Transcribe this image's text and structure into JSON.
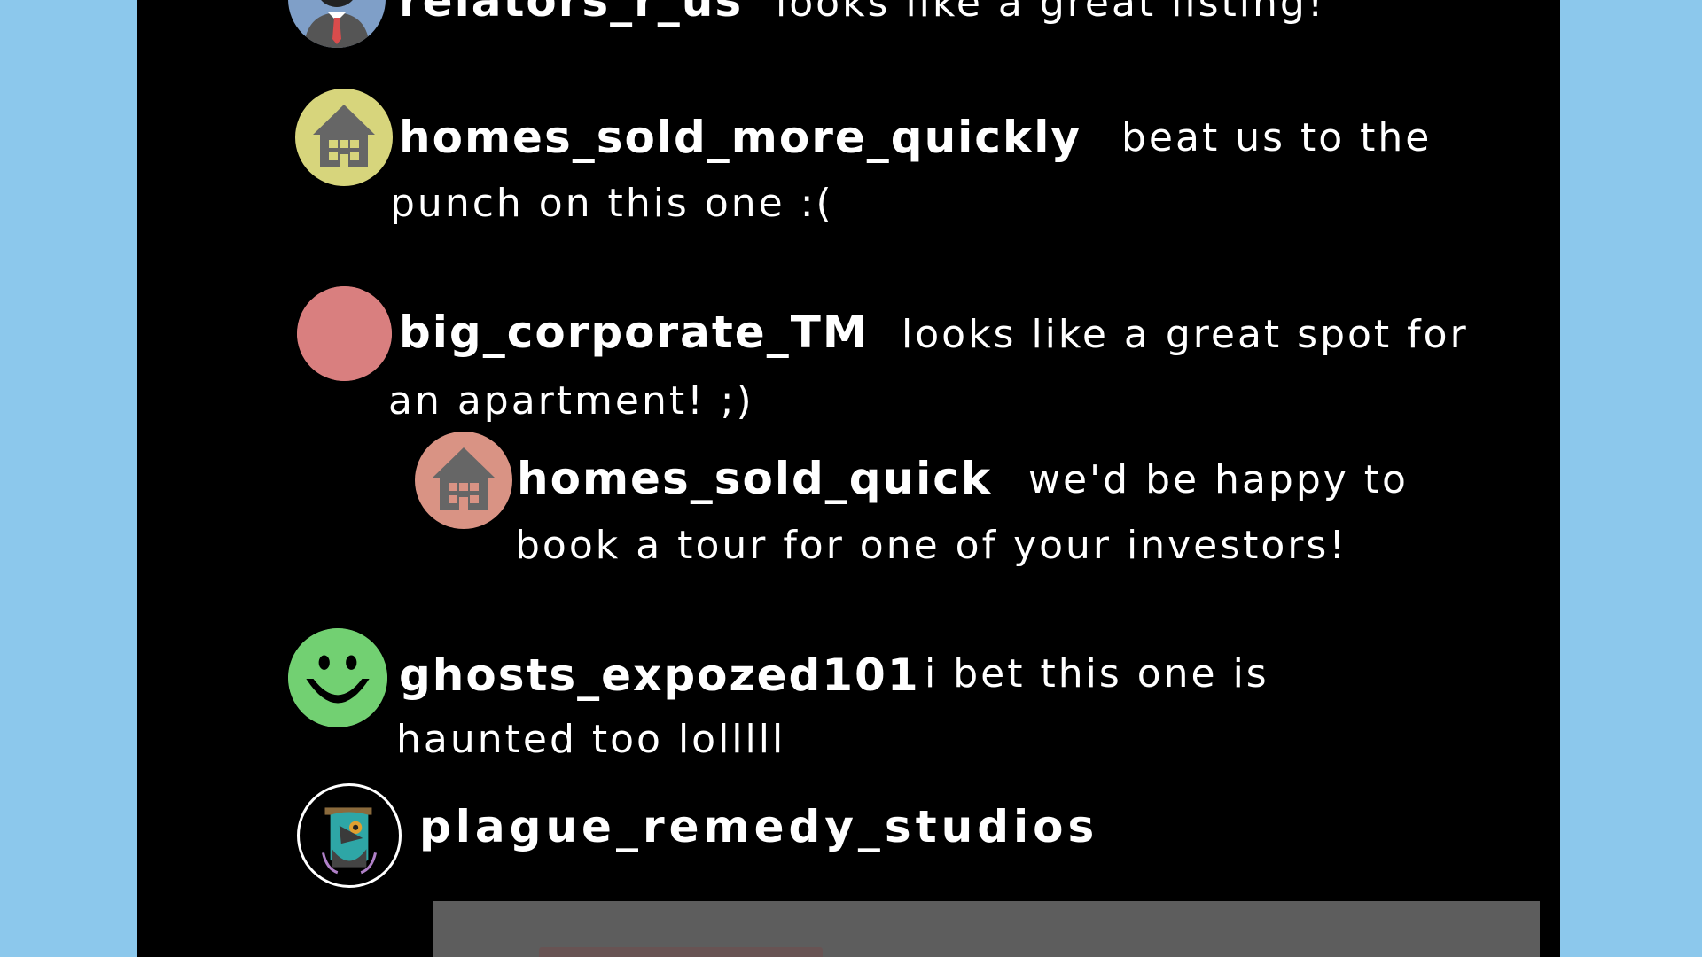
{
  "comments": [
    {
      "username": "relators_r_us",
      "text_line1": "looks like a great listing!",
      "avatar_icon": "businessman-icon",
      "avatar_color": "#7f9fc8"
    },
    {
      "username": "homes_sold_more_quickly",
      "text_line1": "beat us to the",
      "text_line2": "punch on this one :(",
      "avatar_icon": "house-icon",
      "avatar_color": "#d7d57c"
    },
    {
      "username": "big_corporate_TM",
      "text_line1": "looks like a great spot for",
      "text_line2": "an apartment! ;)",
      "avatar_icon": "plain-circle-avatar",
      "avatar_color": "#d97f7f"
    },
    {
      "username": "homes_sold_quick",
      "text_line1": "we'd be happy to",
      "text_line2": "book a tour for one of your investors!",
      "avatar_icon": "house-icon",
      "avatar_color": "#d99384"
    },
    {
      "username": "ghosts_expozed101",
      "text_line1": "i bet this one is",
      "text_line2": "haunted too lolllll",
      "avatar_icon": "smiley-face-icon",
      "avatar_color": "#72d072"
    }
  ],
  "post": {
    "username": "plague_remedy_studios",
    "avatar_icon": "plague-doctor-icon"
  },
  "colors": {
    "background": "#8cc8ec",
    "panel": "#000000",
    "text": "#ffffff"
  }
}
